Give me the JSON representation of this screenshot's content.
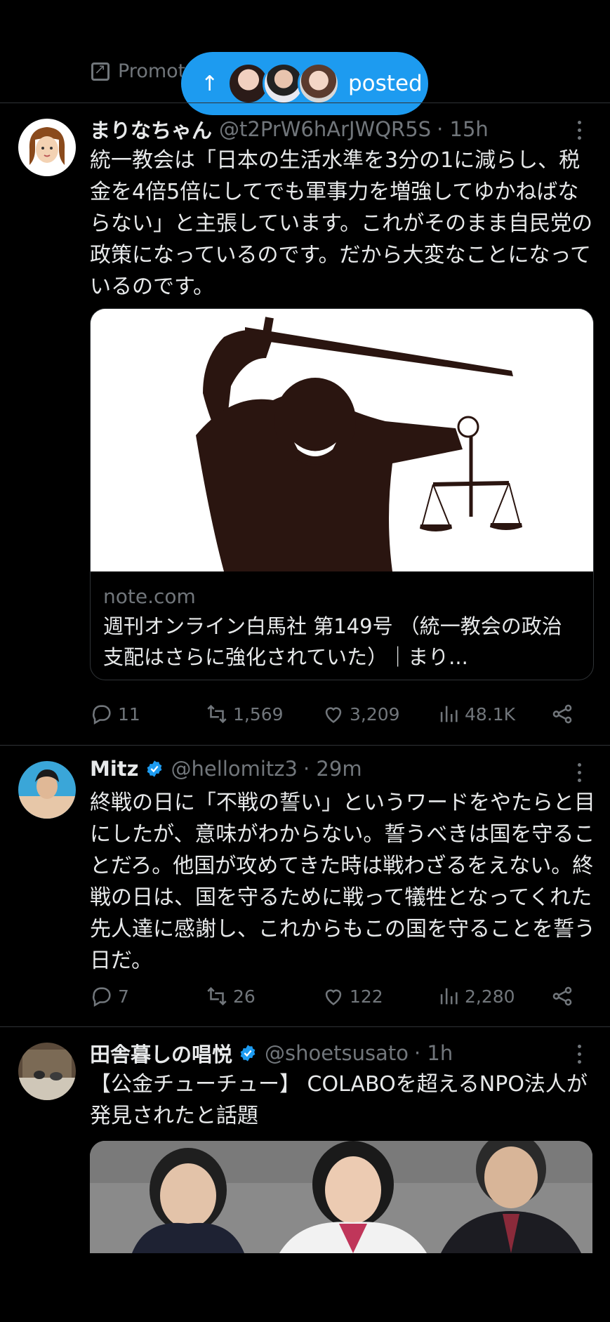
{
  "promoted_text": "Promot",
  "new_posts_pill": {
    "label": "posted"
  },
  "tweets": [
    {
      "name": "まりなちゃん",
      "handle": "@t2PrW6hArJWQR5S",
      "time": "· 15h",
      "verified": false,
      "text": "統一教会は「日本の生活水準を3分の1に減らし、税金を4倍5倍にしてでも軍事力を増強してゆかねばならない」と主張しています。これがそのまま自民党の政策になっているのです。だから大変なことになっているのです。",
      "card": {
        "domain": "note.com",
        "title": "週刊オンライン白馬社 第149号 （統一教会の政治支配はさらに強化されていた）｜まり..."
      },
      "replies": "11",
      "reposts": "1,569",
      "likes": "3,209",
      "views": "48.1K"
    },
    {
      "name": "Mitz",
      "handle": "@hellomitz3",
      "time": "· 29m",
      "verified": true,
      "text": "終戦の日に「不戦の誓い」というワードをやたらと目にしたが、意味がわからない。誓うべきは国を守ることだろ。他国が攻めてきた時は戦わざるをえない。終戦の日は、国を守るために戦って犠牲となってくれた先人達に感謝し、これからもこの国を守ることを誓う日だ。",
      "replies": "7",
      "reposts": "26",
      "likes": "122",
      "views": "2,280"
    },
    {
      "name": "田舎暮しの唱悦",
      "handle": "@shoetsusato",
      "time": "· 1h",
      "verified": true,
      "text": "【公金チューチュー】 COLABOを超えるNPO法人が発見されたと話題"
    }
  ],
  "colors": {
    "accent": "#1d9bf0",
    "muted": "#71767b",
    "text": "#e7e9ea",
    "background": "#000000"
  }
}
